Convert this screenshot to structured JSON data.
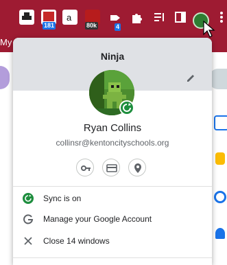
{
  "browser": {
    "bookmark_prefix": "My C",
    "extension_badges": [
      "181",
      "80k",
      "4"
    ]
  },
  "profile_menu": {
    "profile_name": "Ninja",
    "user_name": "Ryan Collins",
    "user_email": "collinsr@kentoncityschools.org",
    "shortcut_buttons": [
      "key-icon",
      "card-icon",
      "location-pin-icon"
    ],
    "items": [
      {
        "icon": "sync-icon",
        "label": "Sync is on"
      },
      {
        "icon": "google-g-icon",
        "label": "Manage your Google Account"
      },
      {
        "icon": "close-icon",
        "label": "Close 14 windows"
      }
    ]
  },
  "colors": {
    "toolbar": "#9e1b32",
    "header": "#dfe1e5",
    "sync_green": "#1e8e3e"
  }
}
